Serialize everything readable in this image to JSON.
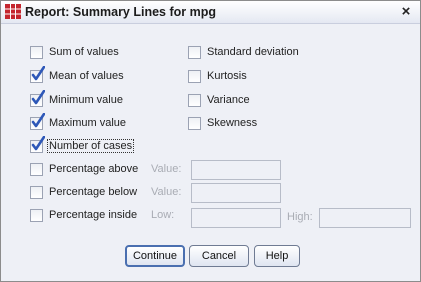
{
  "window": {
    "title": "Report: Summary Lines for mpg",
    "close_glyph": "×"
  },
  "options": {
    "left": [
      {
        "label": "Sum of values",
        "checked": false
      },
      {
        "label": "Mean of values",
        "checked": true
      },
      {
        "label": "Minimum value",
        "checked": true
      },
      {
        "label": "Maximum value",
        "checked": true
      },
      {
        "label": "Number of cases",
        "checked": true
      }
    ],
    "right": [
      {
        "label": "Standard deviation",
        "checked": false
      },
      {
        "label": "Kurtosis",
        "checked": false
      },
      {
        "label": "Variance",
        "checked": false
      },
      {
        "label": "Skewness",
        "checked": false
      }
    ]
  },
  "percentage": {
    "above": {
      "label": "Percentage above",
      "checked": false,
      "value_label": "Value:",
      "value": ""
    },
    "below": {
      "label": "Percentage below",
      "checked": false,
      "value_label": "Value:",
      "value": ""
    },
    "inside": {
      "label": "Percentage inside",
      "checked": false,
      "low_label": "Low:",
      "low": "",
      "high_label": "High:",
      "high": ""
    }
  },
  "buttons": {
    "continue": "Continue",
    "cancel": "Cancel",
    "help": "Help"
  },
  "colors": {
    "check": "#2e58b8",
    "icon_red": "#c4262e"
  }
}
